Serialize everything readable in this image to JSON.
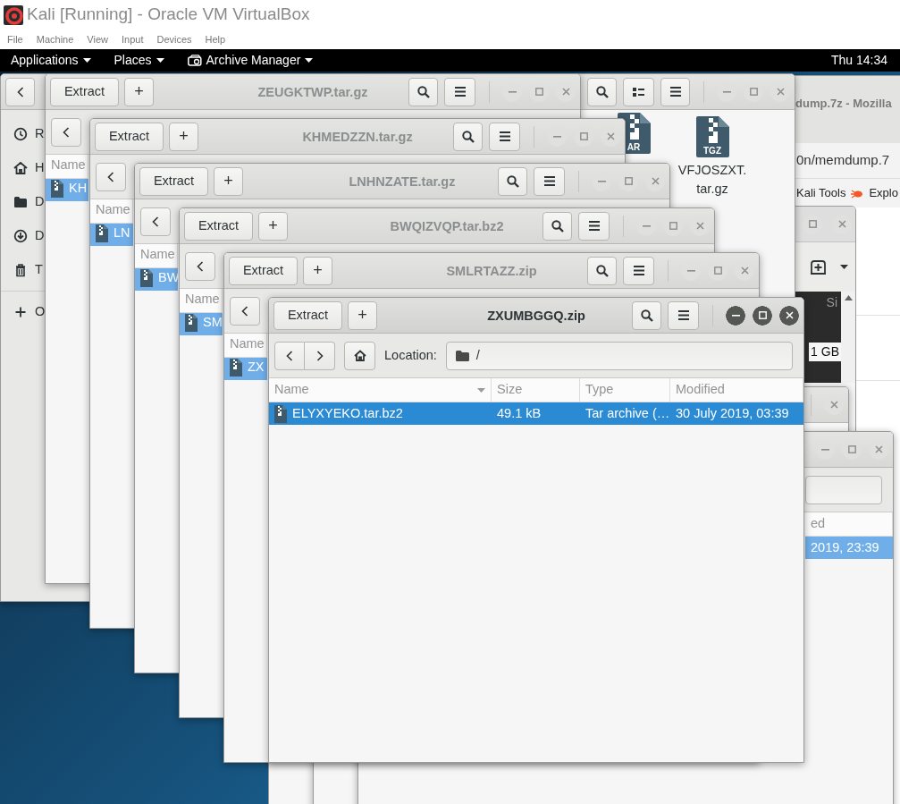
{
  "host": {
    "title": "Kali [Running] - Oracle VM VirtualBox",
    "menu": [
      "File",
      "Machine",
      "View",
      "Input",
      "Devices",
      "Help"
    ]
  },
  "top_bar": {
    "menus": [
      {
        "label": "Applications",
        "kind": "menu"
      },
      {
        "label": "Places",
        "kind": "menu"
      },
      {
        "label": "Archive Manager",
        "kind": "app"
      }
    ],
    "clock": "Thu 14:34"
  },
  "files_window": {
    "sidebar": [
      {
        "label": "R",
        "kind": "recent"
      },
      {
        "label": "H",
        "kind": "home"
      },
      {
        "label": "D",
        "kind": "desktop"
      },
      {
        "label": "D",
        "kind": "downloads"
      },
      {
        "label": "T",
        "kind": "trash"
      },
      {
        "label": "O",
        "kind": "other"
      }
    ],
    "icons": [
      {
        "badge": "AR"
      },
      {
        "badge": "TGZ",
        "name": "VFJOSZXT.tar.gz"
      }
    ]
  },
  "browser_window": {
    "title": "dump.7z - Mozilla",
    "url": "0n/memdump.7",
    "bookmarks": [
      {
        "label": "Kali Tools",
        "kind": "plain"
      },
      {
        "label": "Explo",
        "kind": "bug"
      }
    ]
  },
  "dark_window": {
    "column_header": "Si",
    "cell": "1 GB"
  },
  "archive_windows": [
    {
      "title": "ZEUGKTWP.tar.gz",
      "focused": false,
      "extract": "Extract",
      "add": "+",
      "toolbar": [
        {
          "kind": "back"
        }
      ],
      "columns": [
        {
          "kind": "name",
          "label": "Name"
        }
      ],
      "rows": [
        {
          "selected": true,
          "name": "KH"
        }
      ]
    },
    {
      "title": "KHMEDZZN.tar.gz",
      "focused": false,
      "extract": "Extract",
      "add": "+",
      "toolbar": [
        {
          "kind": "back"
        }
      ],
      "columns": [
        {
          "kind": "name",
          "label": "Name"
        }
      ],
      "rows": [
        {
          "selected": true,
          "name": "LN"
        }
      ]
    },
    {
      "title": "LNHNZATE.tar.gz",
      "focused": false,
      "extract": "Extract",
      "add": "+",
      "toolbar": [
        {
          "kind": "back"
        }
      ],
      "columns": [
        {
          "kind": "name",
          "label": "Name"
        }
      ],
      "rows": [
        {
          "selected": true,
          "name": "BW"
        }
      ]
    },
    {
      "title": "BWQIZVQP.tar.bz2",
      "focused": false,
      "extract": "Extract",
      "add": "+",
      "toolbar": [
        {
          "kind": "back"
        }
      ],
      "columns": [
        {
          "kind": "name",
          "label": "Name"
        }
      ],
      "rows": [
        {
          "selected": true,
          "name": "SM"
        }
      ]
    },
    {
      "title": "SMLRTAZZ.zip",
      "focused": false,
      "extract": "Extract",
      "add": "+",
      "toolbar": [
        {
          "kind": "back"
        }
      ],
      "columns": [
        {
          "kind": "name",
          "label": "Name"
        }
      ],
      "rows": [
        {
          "selected": true,
          "name": "ZX"
        }
      ]
    },
    {
      "title": "ZXUMBGGQ.zip",
      "focused": true,
      "extract": "Extract",
      "add": "+",
      "toolbar": [
        {
          "kind": "back"
        },
        {
          "kind": "forward"
        },
        {
          "kind": "home"
        },
        {
          "kind": "label",
          "text": "Location:"
        },
        {
          "kind": "location",
          "value": "/"
        }
      ],
      "columns": [
        {
          "kind": "name",
          "label": "Name",
          "sorted": true
        },
        {
          "kind": "size",
          "label": "Size"
        },
        {
          "kind": "type",
          "label": "Type"
        },
        {
          "kind": "modified",
          "label": "Modified"
        }
      ],
      "rows": [
        {
          "selected": true,
          "name": "ELYXYEKO.tar.bz2",
          "size": "49.1 kB",
          "type": "Tar archive (…",
          "modified": "30 July 2019, 03:39"
        }
      ]
    },
    {
      "focused": false
    },
    {
      "focused": false,
      "toolbar": [
        {
          "kind": "location"
        }
      ],
      "columns": [
        {
          "kind": "modified",
          "label": "ed"
        }
      ],
      "rows": [
        {
          "selected": true,
          "modified": "2019, 23:39"
        }
      ]
    }
  ]
}
